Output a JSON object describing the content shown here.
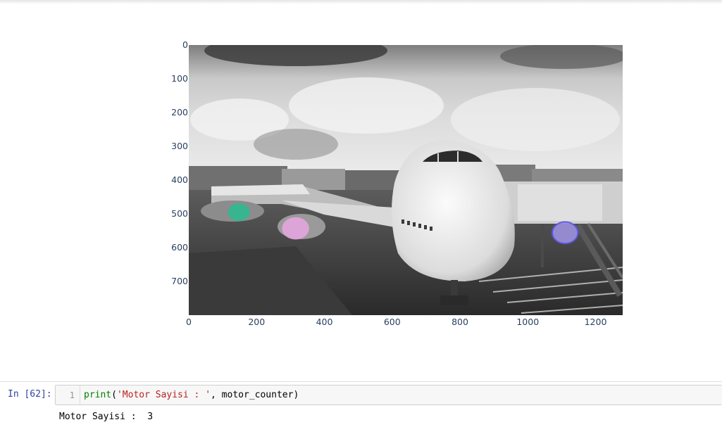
{
  "chart_data": {
    "type": "image",
    "x_ticks": [
      0,
      200,
      400,
      600,
      800,
      1000,
      1200
    ],
    "y_ticks": [
      0,
      100,
      200,
      300,
      400,
      500,
      600,
      700
    ],
    "xlim": [
      0,
      1280
    ],
    "ylim": [
      800,
      0
    ],
    "markers": [
      {
        "color": "#2fb890",
        "x": 148,
        "y": 495,
        "rx": 32,
        "ry": 26
      },
      {
        "color": "#e3a6dc",
        "x": 315,
        "y": 543,
        "rx": 40,
        "ry": 33
      },
      {
        "color": "#9c8fdc",
        "outline": "#5a57e8",
        "x": 1110,
        "y": 556,
        "rx": 38,
        "ry": 32
      }
    ]
  },
  "notebook": {
    "prompt": "In [62]:",
    "line_number": "1",
    "code": {
      "func": "print",
      "open_paren": "(",
      "string": "'Motor Sayisi : '",
      "rest": ", motor_counter",
      "close_paren": ")"
    },
    "output": "Motor Sayisi :  3"
  },
  "colors": {
    "prompt": "#303f9f",
    "func": "#008000",
    "string": "#ba2121",
    "tick": "#2a3f5f"
  }
}
